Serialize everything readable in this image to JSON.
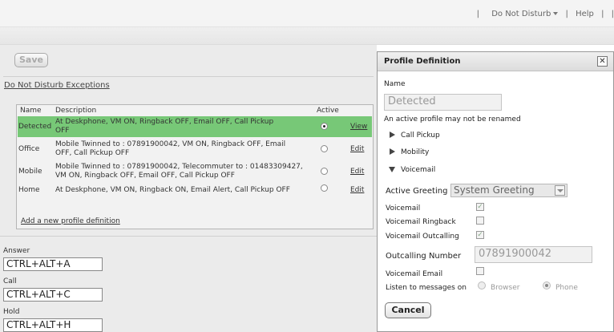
{
  "top_nav": {
    "separator": "|",
    "do_not_disturb": "Do Not Disturb",
    "help": "Help"
  },
  "toolbar": {
    "save_label": "Save"
  },
  "exceptions_link": "Do Not Disturb Exceptions",
  "profiles_table": {
    "headers": {
      "name": "Name",
      "description": "Description",
      "active": "Active"
    },
    "rows": [
      {
        "name": "Detected",
        "description_line1": "At Deskphone, VM ON, Ringback OFF, Email OFF, Call Pickup",
        "description_line2": "OFF",
        "active": true,
        "action": "View"
      },
      {
        "name": "Office",
        "description_line1": "Mobile Twinned to : 07891900042, VM ON, Ringback OFF, Email",
        "description_line2": "OFF, Call Pickup OFF",
        "active": false,
        "action": "Edit"
      },
      {
        "name": "Mobile",
        "description_line1": "Mobile Twinned to : 07891900042, Telecommuter to : 01483309427,",
        "description_line2": "VM ON, Ringback OFF, Email OFF, Call Pickup OFF",
        "active": false,
        "action": "Edit"
      },
      {
        "name": "Home",
        "description_line1": "At Deskphone, VM ON, Ringback ON, Email Alert, Call Pickup OFF",
        "description_line2": "",
        "active": false,
        "action": "Edit"
      }
    ],
    "add_link": "Add a new profile definition"
  },
  "shortcuts": {
    "answer_label": "Answer",
    "answer_value": "CTRL+ALT+A",
    "call_label": "Call",
    "call_value": "CTRL+ALT+C",
    "hold_label": "Hold",
    "hold_value": "CTRL+ALT+H"
  },
  "dialog": {
    "title": "Profile Definition",
    "close_symbol": "✕",
    "name_label": "Name",
    "name_value": "Detected",
    "rename_note": "An active profile may not be renamed",
    "sections": {
      "call_pickup": "Call Pickup",
      "mobility": "Mobility",
      "voicemail": "Voicemail"
    },
    "active_greeting_label": "Active Greeting",
    "active_greeting_value": "System Greeting",
    "voicemail_label": "Voicemail",
    "voicemail_checked": true,
    "voicemail_ringback_label": "Voicemail Ringback",
    "voicemail_ringback_checked": false,
    "voicemail_outcalling_label": "Voicemail Outcalling",
    "voicemail_outcalling_checked": true,
    "outcalling_number_label": "Outcalling Number",
    "outcalling_number_value": "07891900042",
    "voicemail_email_label": "Voicemail Email",
    "voicemail_email_checked": false,
    "listen_label": "Listen to messages on",
    "listen_browser": "Browser",
    "listen_phone": "Phone",
    "listen_selected": "Phone",
    "cancel_label": "Cancel"
  },
  "colors": {
    "selected_row": "#77c877",
    "panel_bg": "#ebebeb",
    "dialog_bg": "#ffffff"
  }
}
